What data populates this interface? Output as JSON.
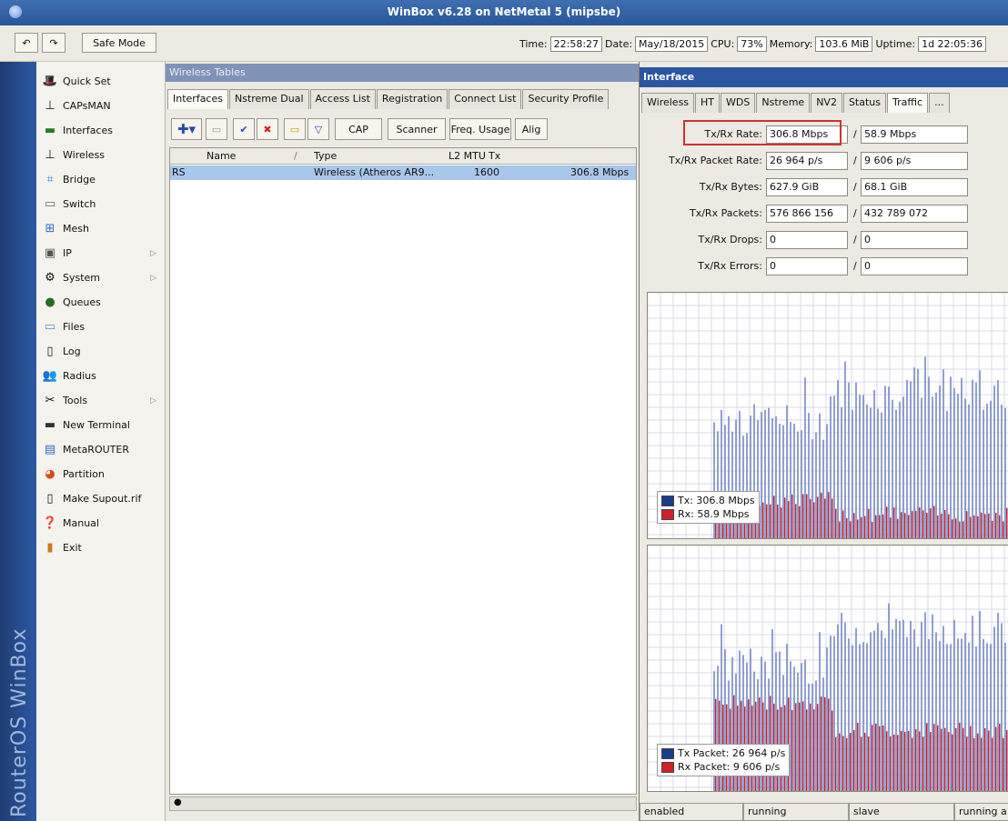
{
  "window": {
    "title": "WinBox v6.28 on NetMetal 5 (mipsbe)"
  },
  "toolbar": {
    "undo_icon": "undo-icon",
    "redo_icon": "redo-icon",
    "safe_mode_label": "Safe Mode",
    "time_label": "Time:",
    "time_value": "22:58:27",
    "date_label": "Date:",
    "date_value": "May/18/2015",
    "cpu_label": "CPU:",
    "cpu_value": "73%",
    "memory_label": "Memory:",
    "memory_value": "103.6 MiB",
    "uptime_label": "Uptime:",
    "uptime_value": "1d 22:05:36"
  },
  "brand": {
    "text": "RouterOS WinBox"
  },
  "menu": {
    "items": [
      {
        "label": "Quick Set",
        "icon": "quickset-icon",
        "submenu": false
      },
      {
        "label": "CAPsMAN",
        "icon": "antenna-icon",
        "submenu": false
      },
      {
        "label": "Interfaces",
        "icon": "interfaces-icon",
        "submenu": false
      },
      {
        "label": "Wireless",
        "icon": "antenna-icon",
        "submenu": false
      },
      {
        "label": "Bridge",
        "icon": "bridge-icon",
        "submenu": false
      },
      {
        "label": "Switch",
        "icon": "switch-icon",
        "submenu": false
      },
      {
        "label": "Mesh",
        "icon": "mesh-icon",
        "submenu": false
      },
      {
        "label": "IP",
        "icon": "ip-icon",
        "submenu": true
      },
      {
        "label": "System",
        "icon": "gear-icon",
        "submenu": true
      },
      {
        "label": "Queues",
        "icon": "queues-icon",
        "submenu": false
      },
      {
        "label": "Files",
        "icon": "folder-icon",
        "submenu": false
      },
      {
        "label": "Log",
        "icon": "log-icon",
        "submenu": false
      },
      {
        "label": "Radius",
        "icon": "users-icon",
        "submenu": false
      },
      {
        "label": "Tools",
        "icon": "tools-icon",
        "submenu": true
      },
      {
        "label": "New Terminal",
        "icon": "terminal-icon",
        "submenu": false
      },
      {
        "label": "MetaROUTER",
        "icon": "metarouter-icon",
        "submenu": false
      },
      {
        "label": "Partition",
        "icon": "pie-icon",
        "submenu": false
      },
      {
        "label": "Make Supout.rif",
        "icon": "document-icon",
        "submenu": false
      },
      {
        "label": "Manual",
        "icon": "help-icon",
        "submenu": false
      },
      {
        "label": "Exit",
        "icon": "exit-icon",
        "submenu": false
      }
    ]
  },
  "wireless": {
    "title": "Wireless Tables",
    "tabs": [
      "Interfaces",
      "Nstreme Dual",
      "Access List",
      "Registration",
      "Connect List",
      "Security Profile"
    ],
    "actions": {
      "cap": "CAP",
      "scanner": "Scanner",
      "freq_usage": "Freq. Usage",
      "align": "Alig"
    },
    "columns": {
      "name": "Name",
      "type": "Type",
      "mtu": "L2 MTU",
      "tx": "Tx"
    },
    "rows": [
      {
        "flag": "RS",
        "name": "",
        "type": "Wireless (Atheros AR9...",
        "mtu": "1600",
        "tx": "306.8 Mbps"
      }
    ]
  },
  "interface": {
    "title": "Interface",
    "tabs": [
      "Wireless",
      "HT",
      "WDS",
      "Nstreme",
      "NV2",
      "Status",
      "Traffic",
      "..."
    ],
    "fields": [
      {
        "label": "Tx/Rx Rate:",
        "tx": "306.8 Mbps",
        "rx": "58.9 Mbps"
      },
      {
        "label": "Tx/Rx Packet Rate:",
        "tx": "26 964 p/s",
        "rx": "9 606 p/s"
      },
      {
        "label": "Tx/Rx Bytes:",
        "tx": "627.9 GiB",
        "rx": "68.1 GiB"
      },
      {
        "label": "Tx/Rx Packets:",
        "tx": "576 866 156",
        "rx": "432 789 072"
      },
      {
        "label": "Tx/Rx Drops:",
        "tx": "0",
        "rx": "0"
      },
      {
        "label": "Tx/Rx Errors:",
        "tx": "0",
        "rx": "0"
      }
    ],
    "separator": "/",
    "graph_rate": {
      "legend": [
        {
          "label": "Tx:  306.8 Mbps",
          "color": "#1a3a8c"
        },
        {
          "label": "Rx:  58.9 Mbps",
          "color": "#d0202a"
        }
      ]
    },
    "graph_packet": {
      "legend": [
        {
          "label": "Tx Packet:  26 964 p/s",
          "color": "#1a3a8c"
        },
        {
          "label": "Rx Packet:  9 606 p/s",
          "color": "#d0202a"
        }
      ]
    },
    "statusbar": [
      "enabled",
      "running",
      "slave",
      "running a"
    ]
  },
  "colors": {
    "tx": "#2e4a9a",
    "rx": "#c8202a",
    "titlebar": "#2b5699",
    "selection": "#a8c7ea"
  }
}
